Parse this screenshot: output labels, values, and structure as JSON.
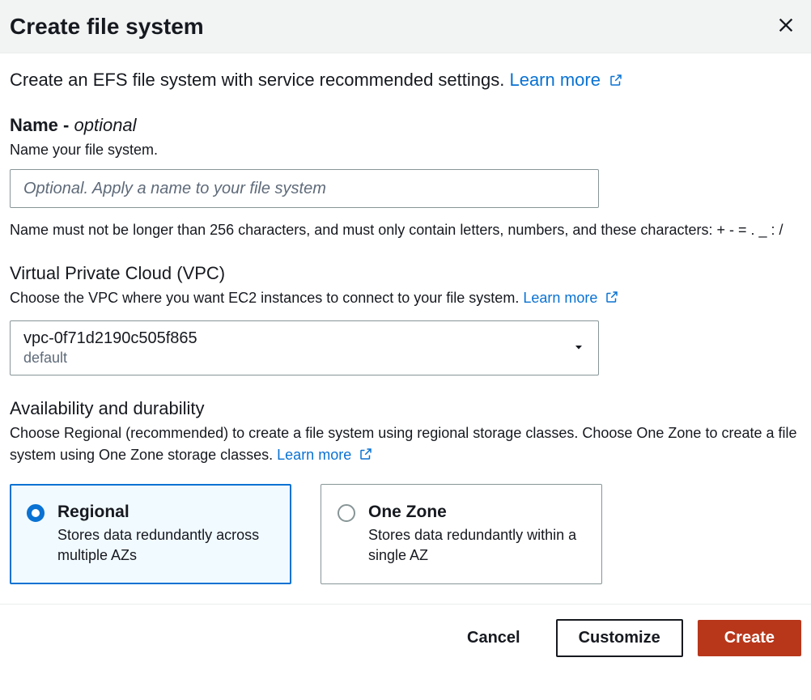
{
  "header": {
    "title": "Create file system"
  },
  "intro": {
    "text": "Create an EFS file system with service recommended settings. ",
    "learn_more": "Learn more"
  },
  "name_field": {
    "label": "Name - ",
    "optional": "optional",
    "desc": "Name your file system.",
    "placeholder": "Optional. Apply a name to your file system",
    "constraint": "Name must not be longer than 256 characters, and must only contain letters, numbers, and these characters: + - = . _ : /"
  },
  "vpc_field": {
    "title": "Virtual Private Cloud (VPC)",
    "desc": "Choose the VPC where you want EC2 instances to connect to your file system. ",
    "learn_more": "Learn more",
    "selected_id": "vpc-0f71d2190c505f865",
    "selected_name": "default"
  },
  "durability_field": {
    "title": "Availability and durability",
    "desc": "Choose Regional (recommended) to create a file system using regional storage classes. Choose One Zone to create a file system using One Zone storage classes. ",
    "learn_more": "Learn more",
    "options": [
      {
        "title": "Regional",
        "desc": "Stores data redundantly across multiple AZs",
        "selected": true
      },
      {
        "title": "One Zone",
        "desc": "Stores data redundantly within a single AZ",
        "selected": false
      }
    ]
  },
  "footer": {
    "cancel": "Cancel",
    "customize": "Customize",
    "create": "Create"
  }
}
